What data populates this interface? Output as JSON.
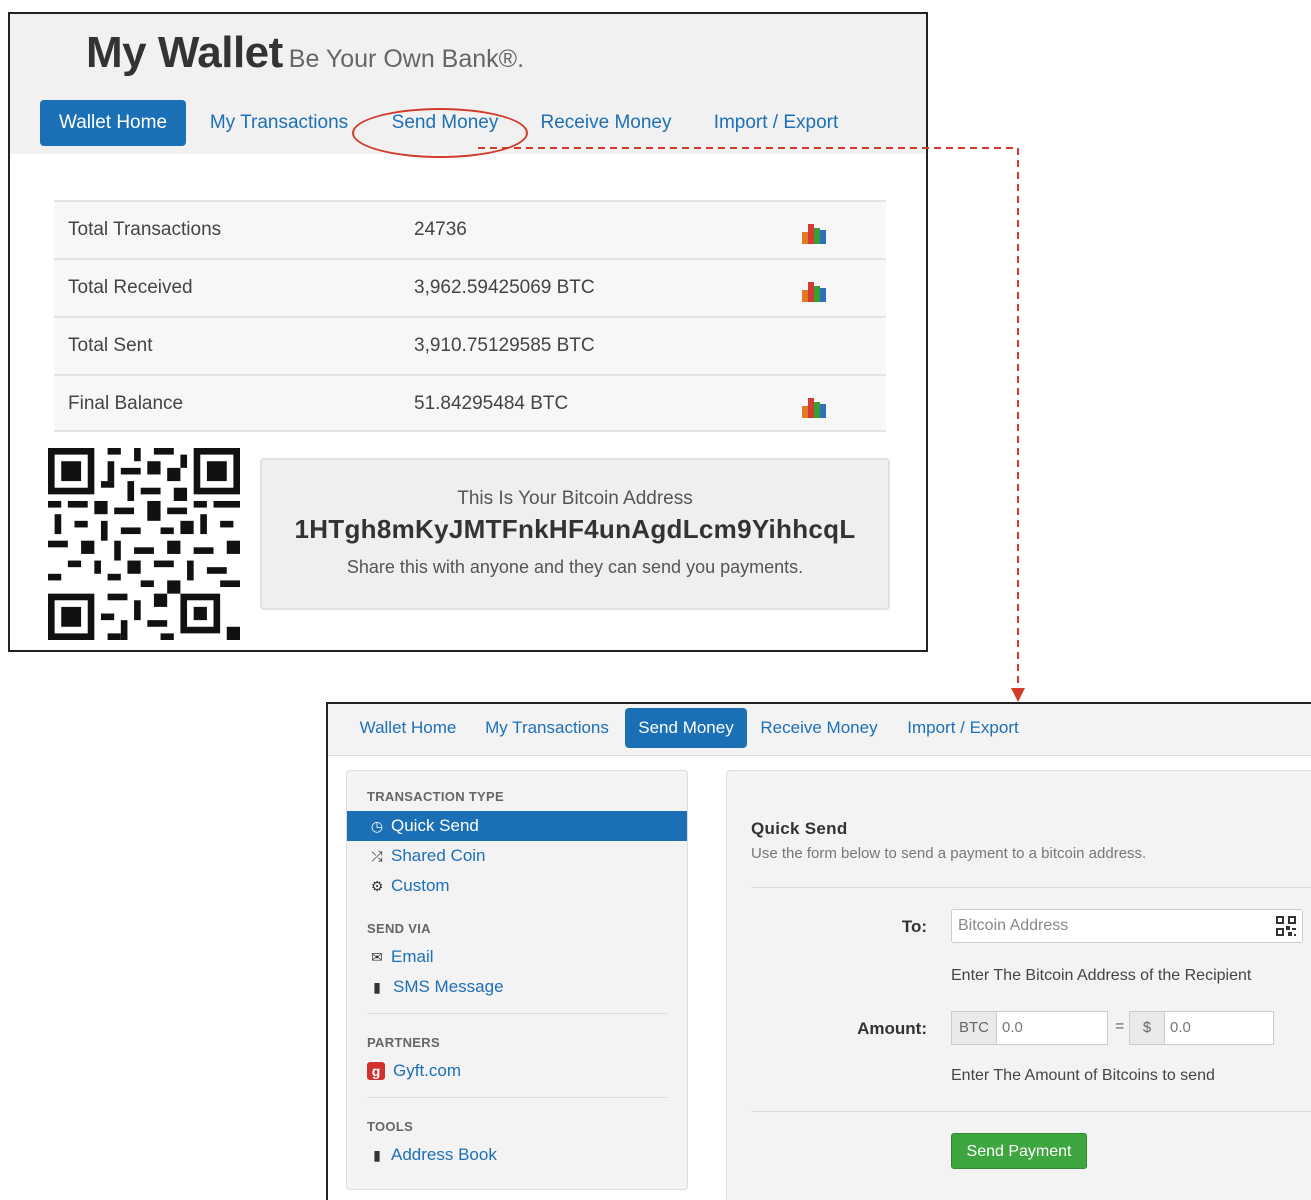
{
  "wallet": {
    "title": "My Wallet",
    "tagline": "Be Your Own Bank®.",
    "nav": [
      {
        "label": "Wallet Home",
        "active": true
      },
      {
        "label": "My Transactions",
        "active": false
      },
      {
        "label": "Send Money",
        "active": false,
        "highlighted": true
      },
      {
        "label": "Receive Money",
        "active": false
      },
      {
        "label": "Import / Export",
        "active": false
      }
    ],
    "stats": [
      {
        "label": "Total Transactions",
        "value": "24736",
        "chart_icon": true
      },
      {
        "label": "Total Received",
        "value": "3,962.59425069 BTC",
        "chart_icon": true
      },
      {
        "label": "Total Sent",
        "value": "3,910.75129585 BTC",
        "chart_icon": false
      },
      {
        "label": "Final Balance",
        "value": "51.84295484 BTC",
        "chart_icon": true
      }
    ],
    "address_box": {
      "heading": "This Is Your Bitcoin Address",
      "address": "1HTgh8mKyJMTFnkHF4unAgdLcm9YihhcqL",
      "note": "Share this with anyone and they can send you payments."
    }
  },
  "send_page": {
    "nav": [
      {
        "label": "Wallet Home",
        "active": false
      },
      {
        "label": "My Transactions",
        "active": false
      },
      {
        "label": "Send Money",
        "active": true
      },
      {
        "label": "Receive Money",
        "active": false
      },
      {
        "label": "Import / Export",
        "active": false
      }
    ],
    "sidebar": {
      "transaction_type_heading": "TRANSACTION TYPE",
      "transaction_types": [
        {
          "label": "Quick Send",
          "icon": "clock-icon",
          "active": true
        },
        {
          "label": "Shared Coin",
          "icon": "shuffle-icon",
          "active": false
        },
        {
          "label": "Custom",
          "icon": "gear-icon",
          "active": false
        }
      ],
      "send_via_heading": "SEND VIA",
      "send_via": [
        {
          "label": "Email",
          "icon": "envelope-icon"
        },
        {
          "label": "SMS Message",
          "icon": "phone-icon"
        }
      ],
      "partners_heading": "PARTNERS",
      "partners": [
        {
          "label": "Gyft.com",
          "icon": "gyft-icon",
          "icon_text": "g"
        }
      ],
      "tools_heading": "TOOLS",
      "tools": [
        {
          "label": "Address Book",
          "icon": "book-icon"
        }
      ]
    },
    "form": {
      "title": "Quick Send",
      "description": "Use the form below to send a payment to a bitcoin address.",
      "to_label": "To:",
      "to_placeholder": "Bitcoin Address",
      "to_help": "Enter The Bitcoin Address of the Recipient",
      "amount_label": "Amount:",
      "btc_addon": "BTC",
      "btc_value": "0.0",
      "equals": "=",
      "usd_addon": "$",
      "usd_value": "0.0",
      "amount_help": "Enter The Amount of Bitcoins to send",
      "send_button": "Send Payment"
    }
  },
  "colors": {
    "accent_blue": "#1a6fb5",
    "link_blue": "#1d6fb8",
    "annotation_red": "#d23a2a",
    "send_green": "#3ea63e"
  }
}
